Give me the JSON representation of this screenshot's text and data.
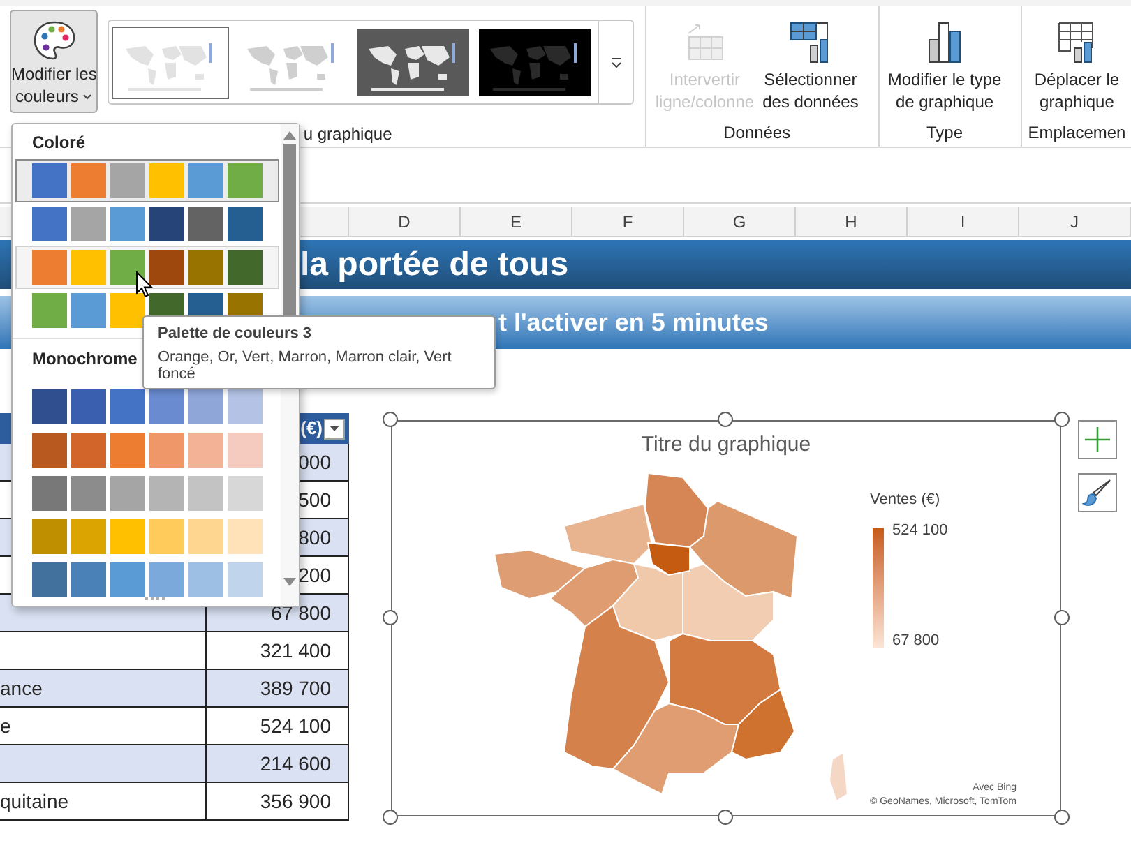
{
  "ribbon": {
    "color_button": {
      "lines": [
        "Modifier les",
        "couleurs"
      ],
      "expanded": true
    },
    "styles": [
      {
        "kind": "white",
        "selected": true
      },
      {
        "kind": "light",
        "selected": false
      },
      {
        "kind": "gray",
        "selected": false
      },
      {
        "kind": "black",
        "selected": false
      }
    ],
    "styles_group_label": "u graphique",
    "groups": [
      {
        "label": "Données",
        "buttons": [
          {
            "lines": [
              "Intervertir",
              "ligne/colonne"
            ],
            "kind": "swap",
            "disabled": true
          },
          {
            "lines": [
              "Sélectionner",
              "des données"
            ],
            "kind": "select",
            "disabled": false
          }
        ]
      },
      {
        "label": "Type",
        "buttons": [
          {
            "lines": [
              "Modifier le type",
              "de graphique"
            ],
            "kind": "chart",
            "disabled": false
          }
        ]
      },
      {
        "label": "Emplacemen",
        "buttons": [
          {
            "lines": [
              "Déplacer le",
              "graphique"
            ],
            "kind": "move",
            "disabled": false
          }
        ]
      }
    ]
  },
  "columns": [
    "D",
    "E",
    "F",
    "G",
    "H",
    "I",
    "J"
  ],
  "banner": "la portée de tous",
  "subtitle": "t l'activer en 5 minutes",
  "table": {
    "header": "(€)",
    "rows": [
      {
        "value": "000"
      },
      {
        "value": "500"
      },
      {
        "value": "800"
      },
      {
        "value": "200"
      },
      {
        "value": "67 800"
      },
      {
        "value": "321 400"
      },
      {
        "name": "ance",
        "value": "389 700"
      },
      {
        "name": "e",
        "value": "524 100"
      },
      {
        "value": "214 600"
      },
      {
        "name": "quitaine",
        "value": "356 900"
      }
    ]
  },
  "chart": {
    "title": "Titre du graphique",
    "legend": {
      "title": "Ventes (€)",
      "max": "524 100",
      "min": "67 800"
    },
    "credit": "Avec Bing",
    "attribution": "© GeoNames, Microsoft, TomTom"
  },
  "dropdown": {
    "sections": [
      {
        "title": "Coloré",
        "palettes": [
          {
            "selected": true,
            "hovered": false,
            "swatches": [
              {
                "color": "#4472c4"
              },
              {
                "color": "#ed7d31"
              },
              {
                "color": "#a5a5a5"
              },
              {
                "color": "#ffc000"
              },
              {
                "color": "#5b9bd5"
              },
              {
                "color": "#70ad47"
              }
            ]
          },
          {
            "selected": false,
            "hovered": false,
            "swatches": [
              {
                "color": "#4472c4"
              },
              {
                "color": "#a5a5a5"
              },
              {
                "color": "#5b9bd5"
              },
              {
                "color": "#264478"
              },
              {
                "color": "#636363"
              },
              {
                "color": "#255e91"
              }
            ]
          },
          {
            "selected": false,
            "hovered": true,
            "swatches": [
              {
                "color": "#ed7d31"
              },
              {
                "color": "#ffc000"
              },
              {
                "color": "#70ad47"
              },
              {
                "color": "#9e480e"
              },
              {
                "color": "#997300"
              },
              {
                "color": "#43682b"
              }
            ]
          },
          {
            "selected": false,
            "hovered": false,
            "swatches": [
              {
                "color": "#70ad47"
              },
              {
                "color": "#5b9bd5"
              },
              {
                "color": "#ffc000"
              },
              {
                "color": "#43682b"
              },
              {
                "color": "#255e91"
              },
              {
                "color": "#997300"
              }
            ]
          }
        ]
      },
      {
        "title": "Monochrome",
        "palettes": [
          {
            "selected": false,
            "hovered": false,
            "swatches": [
              {
                "color": "#2f4f8f"
              },
              {
                "color": "#3a5fae"
              },
              {
                "color": "#4472c4"
              },
              {
                "color": "#6a8bd0"
              },
              {
                "color": "#8fa6d9"
              },
              {
                "color": "#b4c3e5"
              }
            ]
          },
          {
            "selected": false,
            "hovered": false,
            "swatches": [
              {
                "color": "#b85a1f"
              },
              {
                "color": "#d2652a"
              },
              {
                "color": "#ed7d31"
              },
              {
                "color": "#f0976a"
              },
              {
                "color": "#f3b195"
              },
              {
                "color": "#f6cbbf"
              }
            ]
          },
          {
            "selected": false,
            "hovered": false,
            "swatches": [
              {
                "color": "#787878"
              },
              {
                "color": "#8c8c8c"
              },
              {
                "color": "#a5a5a5"
              },
              {
                "color": "#b4b4b4"
              },
              {
                "color": "#c3c3c3"
              },
              {
                "color": "#d7d7d7"
              }
            ]
          },
          {
            "selected": false,
            "hovered": false,
            "swatches": [
              {
                "color": "#bf8f00"
              },
              {
                "color": "#dba400"
              },
              {
                "color": "#ffc000"
              },
              {
                "color": "#ffcc5c"
              },
              {
                "color": "#ffd68f"
              },
              {
                "color": "#ffe2b8"
              }
            ]
          },
          {
            "selected": false,
            "hovered": false,
            "swatches": [
              {
                "color": "#41719c"
              },
              {
                "color": "#4a82b8"
              },
              {
                "color": "#5b9bd5"
              },
              {
                "color": "#7ca9db"
              },
              {
                "color": "#9dbfe4"
              },
              {
                "color": "#c0d4ec"
              }
            ]
          }
        ]
      }
    ]
  },
  "tooltip": {
    "title": "Palette de couleurs 3",
    "text": "Orange, Or, Vert, Marron, Marron clair, Vert foncé"
  }
}
